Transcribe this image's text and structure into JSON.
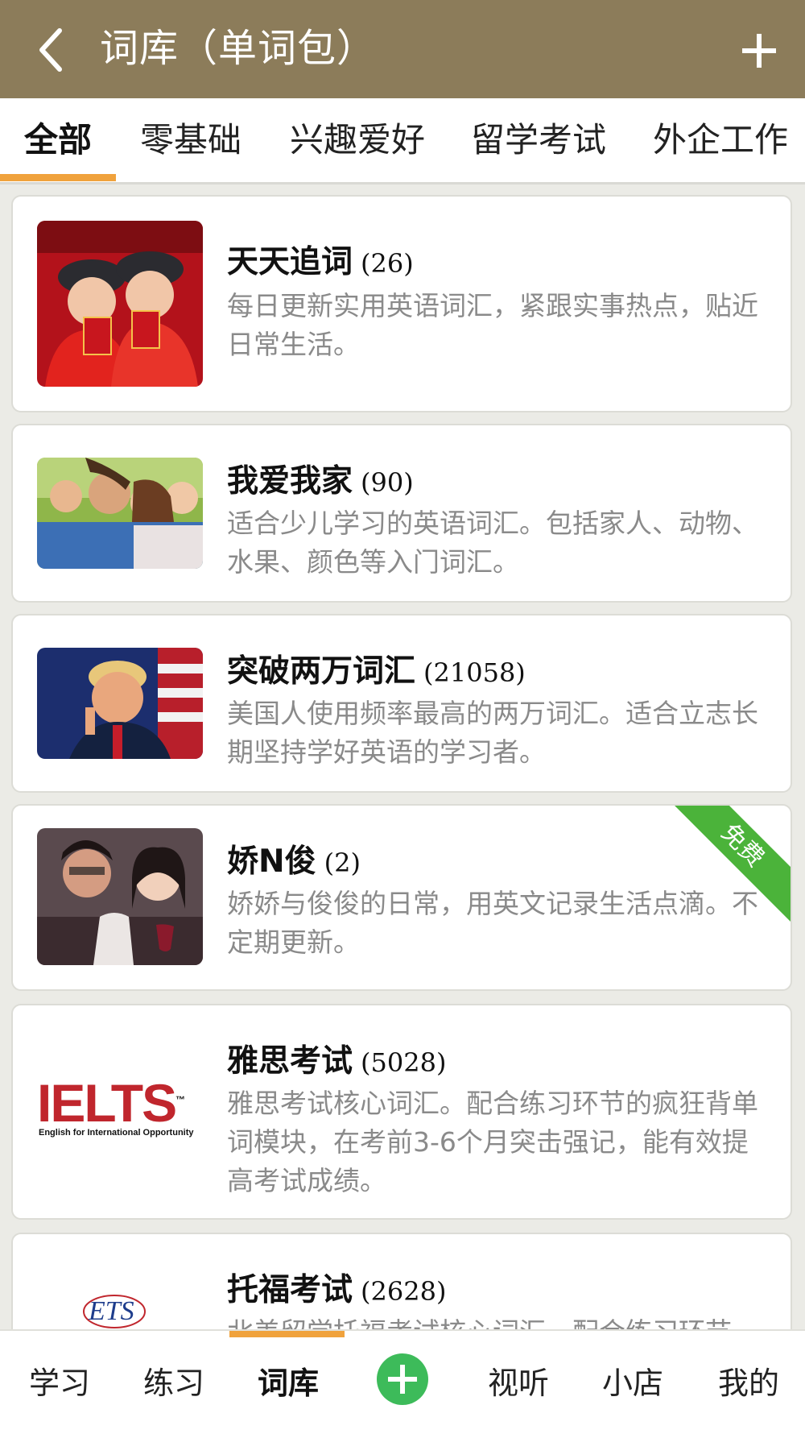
{
  "header": {
    "title": "词库（单词包）"
  },
  "tabs": [
    {
      "label": "全部"
    },
    {
      "label": "零基础"
    },
    {
      "label": "兴趣爱好"
    },
    {
      "label": "留学考试"
    },
    {
      "label": "外企工作"
    }
  ],
  "cards": [
    {
      "title": "天天追词",
      "count": "(26)",
      "desc": "每日更新实用英语词汇，紧跟实事热点，贴近日常生活。"
    },
    {
      "title": "我爱我家",
      "count": "(90)",
      "desc": "适合少儿学习的英语词汇。包括家人、动物、水果、颜色等入门词汇。"
    },
    {
      "title": "突破两万词汇",
      "count": "(21058)",
      "desc": "美国人使用频率最高的两万词汇。适合立志长期坚持学好英语的学习者。"
    },
    {
      "title": "娇N俊",
      "count": "(2)",
      "desc": "娇娇与俊俊的日常，用英文记录生活点滴。不定期更新。",
      "badge": "免费"
    },
    {
      "title": "雅思考试",
      "count": "(5028)",
      "desc": "雅思考试核心词汇。配合练习环节的疯狂背单词模块，在考前3-6个月突击强记，能有效提高考试成绩。",
      "logo": {
        "text": "IELTS",
        "tm": "™",
        "tagline": "English for International Opportunity"
      }
    },
    {
      "title": "托福考试",
      "count": "(2628)",
      "desc": "北美留学托福考试核心词汇。配合练习环节",
      "logo": {
        "text": "ETS"
      }
    }
  ],
  "bottom_nav": [
    {
      "label": "学习"
    },
    {
      "label": "练习"
    },
    {
      "label": "词库"
    },
    {
      "label": "视听"
    },
    {
      "label": "小店"
    },
    {
      "label": "我的"
    }
  ],
  "colors": {
    "header_bg": "#8c7c5a",
    "accent": "#f0a23c",
    "badge": "#4bb33a",
    "add_button": "#3dbb5a"
  }
}
